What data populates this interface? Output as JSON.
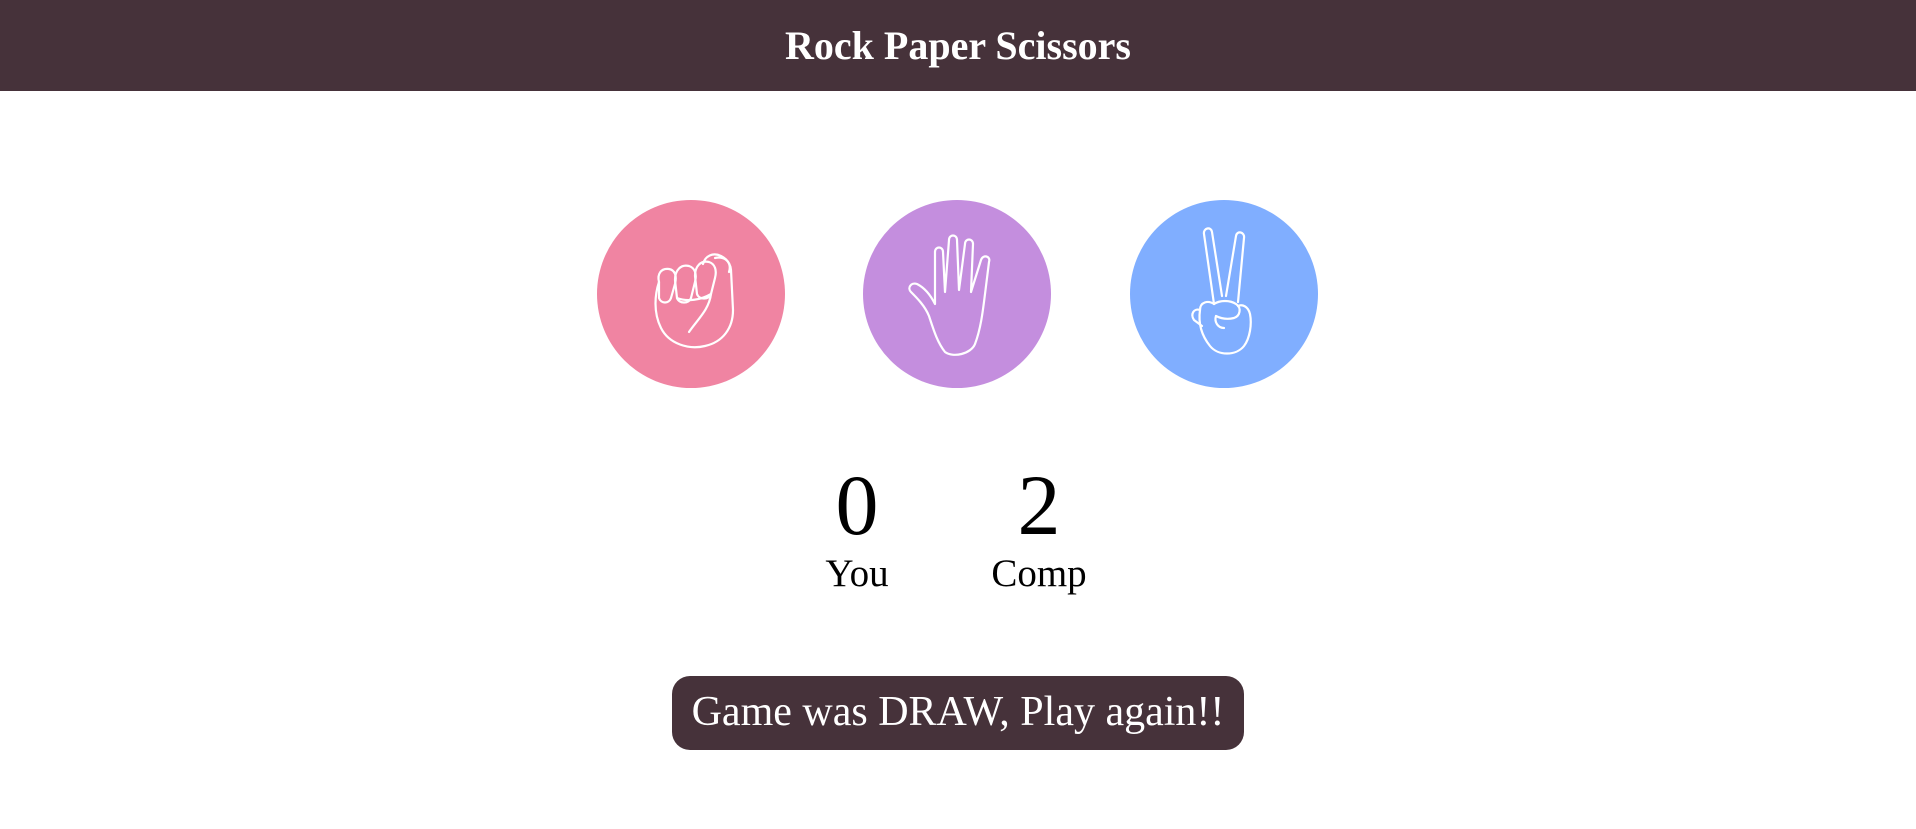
{
  "header": {
    "title": "Rock Paper Scissors"
  },
  "choices": [
    {
      "id": "rock",
      "icon": "rock-hand-icon",
      "color": "#f084a2"
    },
    {
      "id": "paper",
      "icon": "paper-hand-icon",
      "color": "#c48ede"
    },
    {
      "id": "scissors",
      "icon": "scissors-hand-icon",
      "color": "#80aeff"
    }
  ],
  "scoreboard": {
    "user_score": "0",
    "user_label": "You",
    "comp_score": "2",
    "comp_label": "Comp"
  },
  "message": {
    "text": "Game was DRAW, Play again!!"
  },
  "colors": {
    "header_bg": "#46323a",
    "message_bg": "#46323a",
    "rock": "#f084a2",
    "paper": "#c48ede",
    "scissors": "#80aeff"
  }
}
